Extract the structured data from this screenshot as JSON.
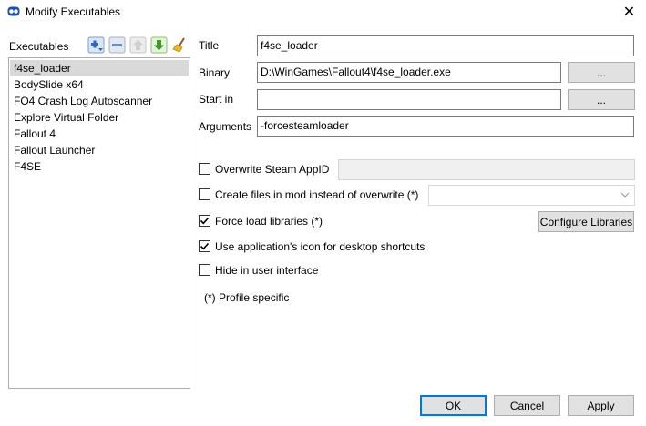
{
  "window": {
    "title": "Modify Executables",
    "close_glyph": "✕"
  },
  "executables": {
    "label": "Executables",
    "toolbar": {
      "add_icon": "add-dropdown-icon",
      "remove_icon": "remove-icon",
      "move_up_icon": "move-up-icon",
      "move_down_icon": "move-down-icon",
      "clean_icon": "broom-icon"
    },
    "items": [
      {
        "label": "f4se_loader",
        "selected": true
      },
      {
        "label": "BodySlide x64"
      },
      {
        "label": "FO4 Crash Log Autoscanner"
      },
      {
        "label": "Explore Virtual Folder"
      },
      {
        "label": "Fallout 4"
      },
      {
        "label": "Fallout Launcher"
      },
      {
        "label": "F4SE"
      }
    ]
  },
  "form": {
    "title_label": "Title",
    "title_value": "f4se_loader",
    "binary_label": "Binary",
    "binary_value": "D:\\WinGames\\Fallout4\\f4se_loader.exe",
    "browse_label": "...",
    "startin_label": "Start in",
    "startin_value": "",
    "arguments_label": "Arguments",
    "arguments_value": "-forcesteamloader"
  },
  "options": {
    "steam_appid_label": "Overwrite Steam AppID",
    "steam_appid_checked": false,
    "create_files_label": "Create files in mod instead of overwrite (*)",
    "create_files_checked": false,
    "force_load_label": "Force load libraries (*)",
    "force_load_checked": true,
    "configure_libraries_label": "Configure Libraries",
    "app_icon_label": "Use application's icon for desktop shortcuts",
    "app_icon_checked": true,
    "hide_label": "Hide in user interface",
    "hide_checked": false,
    "profile_note": "(*) Profile specific"
  },
  "footer": {
    "ok_label": "OK",
    "cancel_label": "Cancel",
    "apply_label": "Apply"
  },
  "colors": {
    "accent": "#0078d7",
    "selection": "#d9d9d9",
    "button_face": "#e1e1e1"
  }
}
